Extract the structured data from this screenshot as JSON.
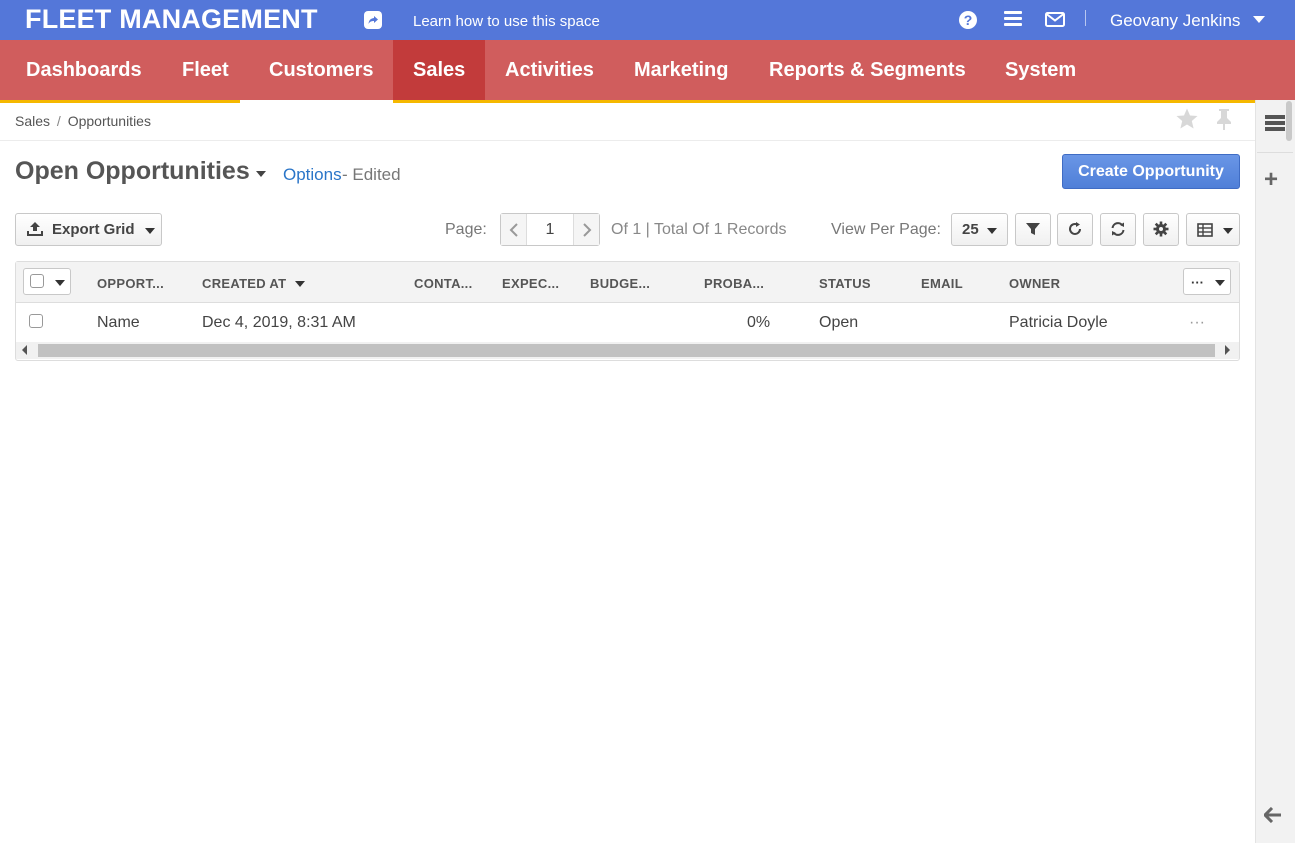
{
  "app": {
    "brand": "FLEET MANAGEMENT",
    "learn_link": "Learn how to use this space",
    "user_name": "Geovany Jenkins",
    "help_glyph": "?"
  },
  "nav": {
    "items": [
      "Dashboards",
      "Fleet",
      "Customers",
      "Sales",
      "Activities",
      "Marketing",
      "Reports & Segments",
      "System"
    ],
    "active": "Sales"
  },
  "breadcrumb": {
    "parent": "Sales",
    "separator": "/",
    "current": "Opportunities"
  },
  "page": {
    "title": "Open Opportunities",
    "options_label": "Options",
    "edited_label": "- Edited",
    "create_button": "Create Opportunity"
  },
  "toolbar": {
    "export_label": "Export Grid",
    "page_label": "Page:",
    "page_number": "1",
    "records_text": "Of 1 | Total Of 1 Records",
    "view_per_page_label": "View Per Page:",
    "per_page_value": "25"
  },
  "grid": {
    "columns": [
      "OPPORT...",
      "CREATED AT",
      "CONTA...",
      "EXPEC...",
      "BUDGE...",
      "PROBA...",
      "STATUS",
      "EMAIL",
      "OWNER"
    ],
    "sorted_column": "CREATED AT",
    "rows": [
      {
        "name": "Name",
        "created_at": "Dec 4, 2019, 8:31 AM",
        "contact": "",
        "expected": "",
        "budget": "",
        "probability": "0%",
        "status": "Open",
        "email": "",
        "owner": "Patricia Doyle",
        "actions": "···"
      }
    ]
  },
  "colors": {
    "topbar": "#5477d9",
    "nav": "#d05d5d",
    "nav_active": "#c23b3b",
    "accent_line": "#f5b800",
    "primary_button": "#5a87de",
    "link": "#2a75c8"
  },
  "icons": [
    "share-icon",
    "help-icon",
    "menu-icon",
    "mail-icon",
    "star-icon",
    "pin-icon",
    "upload-icon",
    "filter-icon",
    "reset-icon",
    "refresh-icon",
    "gear-icon",
    "grid-columns-icon",
    "panel-icon",
    "plus-icon",
    "arrow-left-icon"
  ]
}
